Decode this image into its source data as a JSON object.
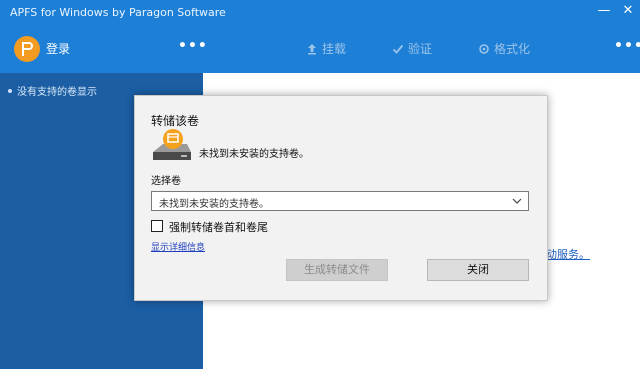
{
  "window": {
    "title": "APFS for Windows by Paragon Software",
    "minimize_glyph": "—",
    "close_glyph": "✕"
  },
  "header": {
    "login_label": "登录",
    "menu_dots": "•••",
    "menu_dots_right": "•••",
    "tools": [
      {
        "label": "挂载",
        "icon": "mount-icon"
      },
      {
        "label": "验证",
        "icon": "check-icon"
      },
      {
        "label": "格式化",
        "icon": "format-icon"
      }
    ]
  },
  "sidebar": {
    "message": "没有支持的卷显示"
  },
  "main": {
    "link_fragment": "动服务。"
  },
  "dialog": {
    "title": "转储该卷",
    "message": "未找到未安装的支持卷。",
    "select_label": "选择卷",
    "select_value": "未找到未安装的支持卷。",
    "checkbox_label": "强制转储卷首和卷尾",
    "details_link": "显示详细信息",
    "generate_button": "生成转储文件",
    "close_button": "关闭"
  },
  "colors": {
    "header_blue": "#1d7fd6",
    "sidebar_blue": "#1b5ea4",
    "logo_orange": "#f49b21"
  }
}
